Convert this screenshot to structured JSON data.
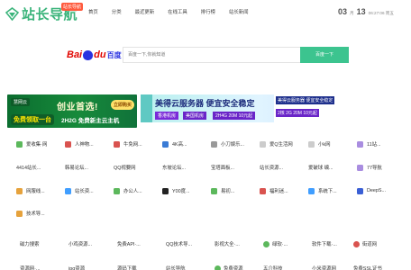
{
  "header": {
    "logo_text": "站长导航",
    "logo_badge": "站长导航",
    "nav": [
      "首页",
      "分类",
      "最近更新",
      "在线工具",
      "排行榜",
      "站长新闻"
    ],
    "date_day": "03",
    "date_month_label": "月",
    "date_num": "13",
    "date_time": "06:27:06 周五"
  },
  "search": {
    "logo_bai": "Bai",
    "logo_du": "du",
    "logo_cn": "百度",
    "placeholder": "百度一下,你就知道",
    "button": "百度一下"
  },
  "banner_left": {
    "logo": "慧网云",
    "title": "创业首选!",
    "button": "立即购买",
    "sub1": "免费领取一台",
    "sub2": "2H2G 免费新主云主机"
  },
  "banner_right": {
    "title": "美得云服务器 便宜安全稳定",
    "tag1": "香港机房",
    "tag2": "美国机房",
    "tag3": "2H4G 20M 10元起",
    "right_head": "美得云服务器 便宜安全稳定",
    "right_tag": "2核 2G 20M 10元起"
  },
  "sites": [
    [
      {
        "label": "爱收集·网",
        "icon": "globe-icon",
        "color": "#5cb85c"
      },
      {
        "label": "人神物...",
        "icon": "site-icon",
        "color": "#d9534f"
      },
      {
        "label": "牛免网...",
        "icon": "site-icon",
        "color": "#d9534f"
      },
      {
        "label": "4K高...",
        "icon": "site-icon",
        "color": "#3a7bd5"
      },
      {
        "label": "小刀娱乐...",
        "icon": "site-icon",
        "color": "#999999"
      },
      {
        "label": "爱Q生活网",
        "icon": "site-icon",
        "color": "#cccccc"
      },
      {
        "label": "小k网",
        "icon": "site-icon",
        "color": "#cccccc"
      },
      {
        "label": "11站...",
        "icon": "site-icon",
        "color": "#a98de0"
      }
    ],
    [
      {
        "label": "4414站长...",
        "icon": "",
        "color": ""
      },
      {
        "label": "韩易论坛...",
        "icon": "",
        "color": ""
      },
      {
        "label": "QQ视要网",
        "icon": "",
        "color": ""
      },
      {
        "label": "东坡论坛...",
        "icon": "",
        "color": ""
      },
      {
        "label": "宝塔面板...",
        "icon": "",
        "color": ""
      },
      {
        "label": "站长资源...",
        "icon": "",
        "color": ""
      },
      {
        "label": "爱破球 编...",
        "icon": "",
        "color": ""
      },
      {
        "label": "77导航",
        "icon": "site-icon",
        "color": "#a98de0"
      }
    ],
    [
      {
        "label": "网服线...",
        "icon": "site-icon",
        "color": "#e6a23c"
      },
      {
        "label": "站长资...",
        "icon": "site-icon",
        "color": "#409eff"
      },
      {
        "label": "办公人...",
        "icon": "site-icon",
        "color": "#5cb85c"
      },
      {
        "label": "Y00度...",
        "icon": "site-icon",
        "color": "#222222"
      },
      {
        "label": "易初...",
        "icon": "site-icon",
        "color": "#5cb85c"
      },
      {
        "label": "福利迷...",
        "icon": "site-icon",
        "color": "#d9534f"
      },
      {
        "label": "系统下...",
        "icon": "site-icon",
        "color": "#409eff"
      },
      {
        "label": "DeepS...",
        "icon": "site-icon",
        "color": "#3a5fd5"
      }
    ],
    [
      {
        "label": "技术导...",
        "icon": "site-icon",
        "color": "#e6a23c"
      }
    ]
  ],
  "bottom": [
    [
      {
        "label": "磁力搜索",
        "icon": "",
        "color": ""
      },
      {
        "label": "小鸡资源...",
        "icon": "",
        "color": ""
      },
      {
        "label": "免费API·...",
        "icon": "",
        "color": ""
      },
      {
        "label": "QQ技术导...",
        "icon": "",
        "color": ""
      },
      {
        "label": "影视大全·...",
        "icon": "",
        "color": ""
      },
      {
        "label": "绿软·...",
        "icon": "circle-icon",
        "color": "#5cb85c"
      },
      {
        "label": "软件下载·...",
        "icon": "",
        "color": ""
      },
      {
        "label": "街道网",
        "icon": "circle-icon",
        "color": "#d9534f"
      }
    ],
    [
      {
        "label": "资源网·...",
        "icon": "",
        "color": ""
      },
      {
        "label": "ipq资源",
        "icon": "",
        "color": ""
      },
      {
        "label": "源码下载",
        "icon": "",
        "color": ""
      },
      {
        "label": "站长导航",
        "icon": "",
        "color": ""
      },
      {
        "label": "免费资源",
        "icon": "circle-icon",
        "color": "#5cb85c"
      },
      {
        "label": "五介科技",
        "icon": "",
        "color": ""
      },
      {
        "label": "小米资源网",
        "icon": "",
        "color": ""
      },
      {
        "label": "免费SSL证书",
        "icon": "",
        "color": ""
      }
    ]
  ]
}
